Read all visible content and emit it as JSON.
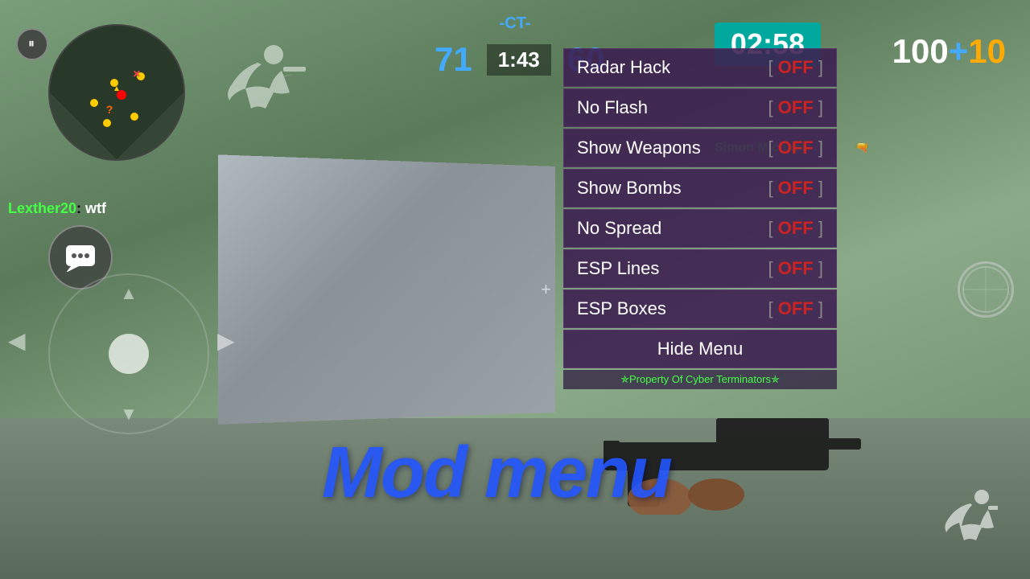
{
  "game": {
    "team_label": "-CT-",
    "kills": "71",
    "time_elapsed": "1:43",
    "score": "60",
    "timer": "02:58",
    "health": "100",
    "health_symbol": "+",
    "health_extra": "10"
  },
  "chat": {
    "player_name": "Lexther20",
    "separator": ":",
    "message": " wtf"
  },
  "player_name_label": "Simon Michael",
  "mod_menu": {
    "title": "Mod Menu",
    "items": [
      {
        "label": "Radar Hack",
        "status": "OFF"
      },
      {
        "label": "No Flash",
        "status": "OFF"
      },
      {
        "label": "Show Weapons",
        "status": "OFF"
      },
      {
        "label": "Show Bombs",
        "status": "OFF"
      },
      {
        "label": "No Spread",
        "status": "OFF"
      },
      {
        "label": "ESP Lines",
        "status": "OFF"
      },
      {
        "label": "ESP Boxes",
        "status": "OFF"
      }
    ],
    "hide_button": "Hide Menu",
    "footer": "✯Property Of Cyber Terminators✯"
  },
  "watermark": "Mod menu",
  "icons": {
    "pause": "⏸",
    "chat_bubble": "💬",
    "arrow_left": "◀",
    "arrow_right": "▶",
    "arrow_up": "▲",
    "arrow_down": "▼",
    "crosshair": "⊕"
  }
}
